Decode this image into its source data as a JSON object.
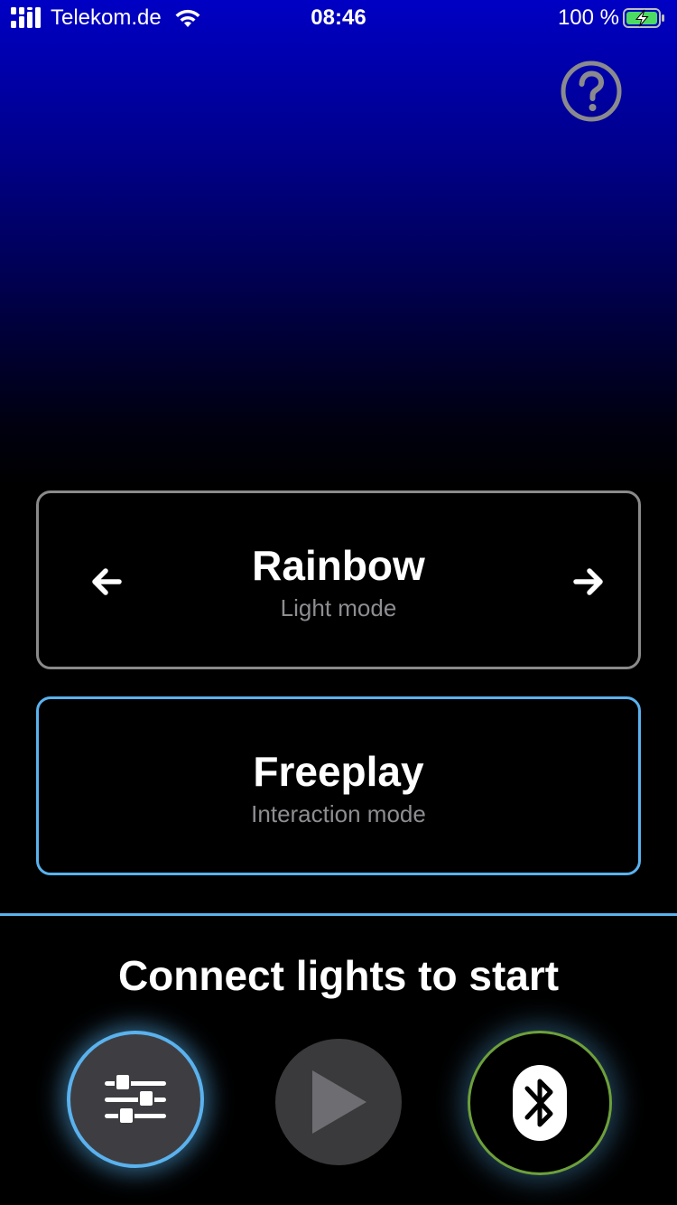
{
  "status_bar": {
    "carrier": "Telekom.de",
    "time": "08:46",
    "battery": "100 %"
  },
  "help": {
    "icon": "question-circle-icon"
  },
  "modes": [
    {
      "title": "Rainbow",
      "subtitle": "Light mode"
    },
    {
      "title": "Freeplay",
      "subtitle": "Interaction mode"
    }
  ],
  "footer": {
    "prompt": "Connect lights to start",
    "buttons": [
      {
        "icon": "sliders-icon"
      },
      {
        "icon": "play-icon"
      },
      {
        "icon": "bluetooth-icon"
      }
    ]
  },
  "colors": {
    "accent_blue": "#5ab2ee",
    "bluetooth_ring": "#6da03a",
    "card_border": "#8a8a8a",
    "subtitle_gray": "#8d8d92",
    "background_top": "#0000c4"
  }
}
